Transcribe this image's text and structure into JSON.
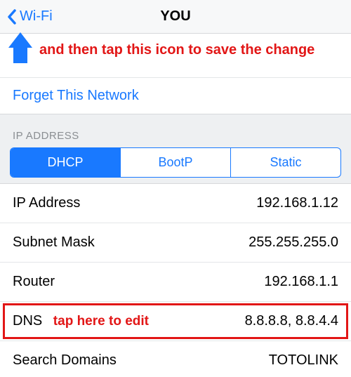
{
  "nav": {
    "back_label": "Wi-Fi",
    "title": "YOU"
  },
  "annotation_top": "and then tap this icon to save the change",
  "forget_label": "Forget This Network",
  "section_header": "IP ADDRESS",
  "segments": {
    "dhcp": "DHCP",
    "bootp": "BootP",
    "static_": "Static"
  },
  "rows": {
    "ip": {
      "label": "IP Address",
      "value": "192.168.1.12"
    },
    "subnet": {
      "label": "Subnet Mask",
      "value": "255.255.255.0"
    },
    "router": {
      "label": "Router",
      "value": "192.168.1.1"
    },
    "dns": {
      "label": "DNS",
      "value": "8.8.8.8, 8.8.4.4",
      "annotation": "tap here to edit"
    },
    "search": {
      "label": "Search Domains",
      "value": "TOTOLINK"
    }
  }
}
